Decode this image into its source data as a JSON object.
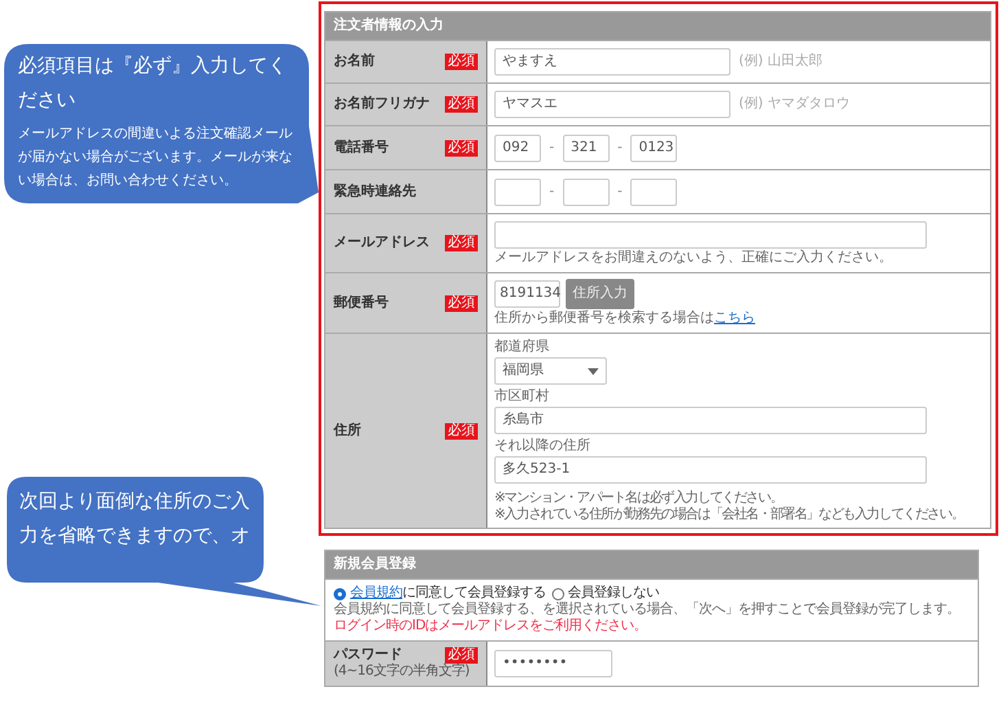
{
  "callouts": [
    {
      "title": "必須項目は『必ず』入力してください",
      "body": "メールアドレスの間違いよる注文確認メールが届かない場合がございます。メールが来ない場合は、お問い合わせください。"
    },
    {
      "title": "次回より面倒な住所のご入力を省略できますので、オ"
    }
  ],
  "order_form": {
    "title": "注文者情報の入力",
    "rows": [
      {
        "kind": "text",
        "label": "お名前",
        "badge": "必須",
        "value": "やますえ",
        "example": "(例) 山田太郎"
      },
      {
        "kind": "text",
        "label": "お名前フリガナ",
        "badge": "必須",
        "value": "ヤマスエ",
        "example": "(例) ヤマダタロウ"
      },
      {
        "kind": "tel",
        "label": "電話番号",
        "badge": "必須",
        "parts": [
          {
            "value": "092"
          },
          {
            "value": "321"
          },
          {
            "value": "0123"
          }
        ],
        "separators": [
          "-",
          "-"
        ]
      },
      {
        "kind": "tel",
        "label": "緊急時連絡先",
        "separators": [
          "-",
          "-"
        ]
      },
      {
        "kind": "email",
        "label": "メールアドレス",
        "badge": "必須",
        "note": "メールアドレスをお間違えのないよう、正確にご入力ください。"
      },
      {
        "kind": "postal",
        "label": "郵便番号",
        "badge": "必須",
        "value": "8191134",
        "button": "住所入力",
        "note": "住所から郵便番号を検索する場合は",
        "link": "こちら"
      },
      {
        "kind": "address",
        "label": "住所",
        "badge": "必須",
        "prefecture_label": "都道府県",
        "prefecture": "福岡県",
        "city_label": "市区町村",
        "city": "糸島市",
        "rest_label": "それ以降の住所",
        "rest": "多久523-1",
        "notes": [
          "※マンション・アパート名は必ず入力してください。",
          "※入力されている住所が勤務先の場合は「会社名・部署名」なども入力してください。"
        ]
      }
    ]
  },
  "member_form": {
    "title": "新規会員登録",
    "options": [
      {
        "link": "会員規約",
        "label": "に同意して会員登録する",
        "selected": true
      },
      {
        "label": "会員登録しない",
        "selected": false
      }
    ],
    "note": "会員規約に同意して会員登録する、を選択されている場合、「次へ」を押すことで会員登録が完了します。",
    "warning": "ログイン時のIDはメールアドレスをご利用ください。",
    "password": {
      "label": "パスワード",
      "sublabel": "(4~16文字の半角文字)",
      "badge": "必須",
      "value": "••••••••"
    }
  }
}
